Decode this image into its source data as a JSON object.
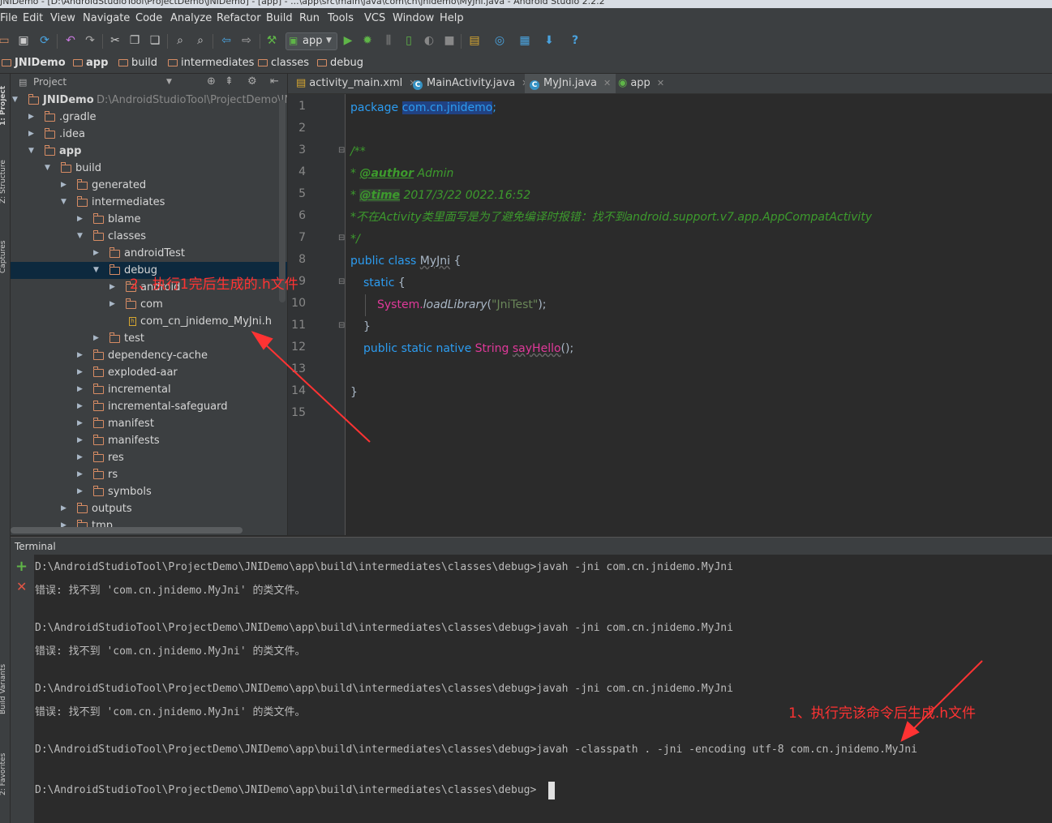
{
  "window": {
    "title": "JNIDemo - [D:\\AndroidStudioTool\\ProjectDemo\\JNIDemo] - [app] - ...\\app\\src\\main\\java\\com\\cn\\jnidemo\\MyJni.java - Android Studio 2.2.2"
  },
  "menu": [
    "File",
    "Edit",
    "View",
    "Navigate",
    "Code",
    "Analyze",
    "Refactor",
    "Build",
    "Run",
    "Tools",
    "VCS",
    "Window",
    "Help"
  ],
  "toolbar": {
    "run_config": "app",
    "help": "?"
  },
  "breadcrumb": [
    "JNIDemo",
    "app",
    "build",
    "intermediates",
    "classes",
    "debug"
  ],
  "left_strip": {
    "project": "1: Project",
    "structure": "Z: Structure",
    "captures": "Captures",
    "build_variants": "Build Variants",
    "favorites": "2: Favorites"
  },
  "project_panel": {
    "title": "Project",
    "root_path": "D:\\AndroidStudioTool\\ProjectDemo\\JNID",
    "tree": [
      {
        "label": "JNIDemo",
        "arrow": "▼"
      },
      {
        "label": ".gradle",
        "arrow": "▶"
      },
      {
        "label": ".idea",
        "arrow": "▶"
      },
      {
        "label": "app",
        "arrow": "▼"
      },
      {
        "label": "build",
        "arrow": "▼"
      },
      {
        "label": "generated",
        "arrow": "▶"
      },
      {
        "label": "intermediates",
        "arrow": "▼"
      },
      {
        "label": "blame",
        "arrow": "▶"
      },
      {
        "label": "classes",
        "arrow": "▼"
      },
      {
        "label": "androidTest",
        "arrow": "▶"
      },
      {
        "label": "debug",
        "arrow": "▼"
      },
      {
        "label": "android",
        "arrow": "▶"
      },
      {
        "label": "com",
        "arrow": "▶"
      },
      {
        "label": "com_cn_jnidemo_MyJni.h",
        "arrow": ""
      },
      {
        "label": "test",
        "arrow": "▶"
      },
      {
        "label": "dependency-cache",
        "arrow": "▶"
      },
      {
        "label": "exploded-aar",
        "arrow": "▶"
      },
      {
        "label": "incremental",
        "arrow": "▶"
      },
      {
        "label": "incremental-safeguard",
        "arrow": "▶"
      },
      {
        "label": "manifest",
        "arrow": "▶"
      },
      {
        "label": "manifests",
        "arrow": "▶"
      },
      {
        "label": "res",
        "arrow": "▶"
      },
      {
        "label": "rs",
        "arrow": "▶"
      },
      {
        "label": "symbols",
        "arrow": "▶"
      },
      {
        "label": "outputs",
        "arrow": "▶"
      },
      {
        "label": "tmp",
        "arrow": "▶"
      }
    ]
  },
  "editor_tabs": [
    "activity_main.xml",
    "MainActivity.java",
    "MyJni.java",
    "app"
  ],
  "code": {
    "line_numbers": [
      "1",
      "2",
      "3",
      "4",
      "5",
      "6",
      "7",
      "8",
      "9",
      "10",
      "11",
      "12",
      "13",
      "14",
      "15"
    ],
    "l1_kw": "package",
    "l1_pkg": "com.cn.jnidemo",
    "l1_end": ";",
    "l3": "/**",
    "l4_star": " * ",
    "l4_tag": "@author",
    "l4_val": " Admin",
    "l5_star": " * ",
    "l5_tag": "@time",
    "l5_val": " 2017/3/22 0022.16:52",
    "l6": " *不在Activity类里面写是为了避免编译时报错：找不到android.support.v7.app.AppCompatActivity",
    "l7": " */",
    "l8_kw": "public class ",
    "l8_name": "MyJni",
    "l8_end": " {",
    "l9_kw": "static",
    "l9_end": " {",
    "l10_cls": "System.",
    "l10_m": "loadLibrary",
    "l10_p1": "(",
    "l10_s": "\"JniTest\"",
    "l10_p2": ");",
    "l11": "}",
    "l12_kw": "public static native ",
    "l12_type": "String ",
    "l12_m": "sayHello",
    "l12_end": "();",
    "l14": "}"
  },
  "terminal": {
    "title": "Terminal",
    "lines": [
      "D:\\AndroidStudioTool\\ProjectDemo\\JNIDemo\\app\\build\\intermediates\\classes\\debug>javah -jni com.cn.jnidemo.MyJni",
      "错误: 找不到 'com.cn.jnidemo.MyJni' 的类文件。",
      "",
      "D:\\AndroidStudioTool\\ProjectDemo\\JNIDemo\\app\\build\\intermediates\\classes\\debug>javah -jni com.cn.jnidemo.MyJni",
      "错误: 找不到 'com.cn.jnidemo.MyJni' 的类文件。",
      "",
      "D:\\AndroidStudioTool\\ProjectDemo\\JNIDemo\\app\\build\\intermediates\\classes\\debug>javah -jni com.cn.jnidemo.MyJni",
      "错误: 找不到 'com.cn.jnidemo.MyJni' 的类文件。",
      "",
      "D:\\AndroidStudioTool\\ProjectDemo\\JNIDemo\\app\\build\\intermediates\\classes\\debug>javah -classpath . -jni -encoding utf-8 com.cn.jnidemo.MyJni",
      "",
      "D:\\AndroidStudioTool\\ProjectDemo\\JNIDemo\\app\\build\\intermediates\\classes\\debug>"
    ]
  },
  "annotations": {
    "note1": "1、执行完该命令后生成.h文件",
    "note2": "2、执行1完后生成的.h文件",
    "color": "#ff3333"
  }
}
